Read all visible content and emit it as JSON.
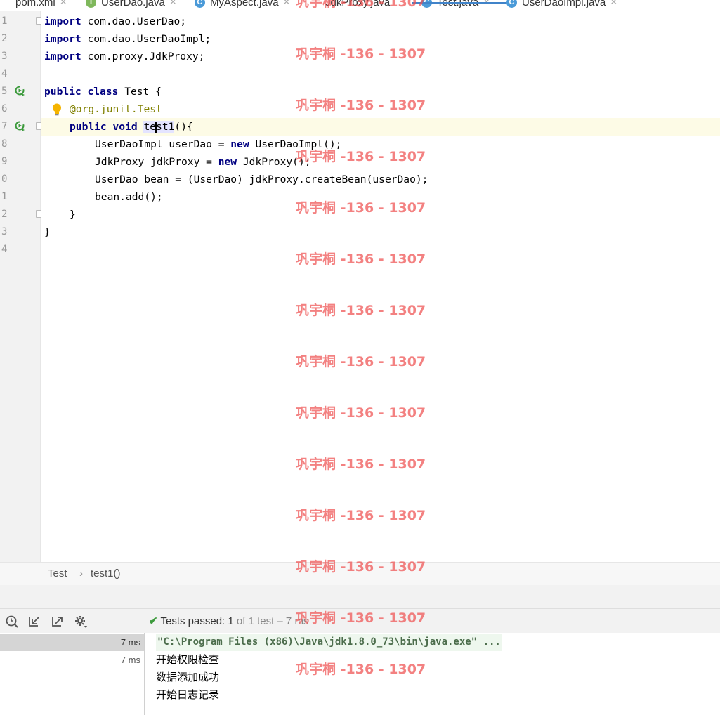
{
  "tabs": [
    {
      "label": "pom.xml",
      "icon": "maven-icon"
    },
    {
      "label": "UserDao.java",
      "icon": "interface-icon"
    },
    {
      "label": "MyAspect.java",
      "icon": "class-icon"
    },
    {
      "label": "JdkProxy.java",
      "icon": "class-icon"
    },
    {
      "label": "Test.java",
      "icon": "class-icon",
      "active": true
    },
    {
      "label": "UserDaoImpl.java",
      "icon": "class-icon"
    }
  ],
  "gutter": {
    "line_numbers": [
      "1",
      "2",
      "3",
      "4",
      "5",
      "6",
      "7",
      "8",
      "9",
      "0",
      "1",
      "2",
      "3",
      "4"
    ]
  },
  "code": {
    "l1": {
      "kw": "import",
      "rest": " com.dao.UserDao;"
    },
    "l2": {
      "kw": "import",
      "rest": " com.dao.UserDaoImpl;"
    },
    "l3": {
      "kw": "import",
      "rest": " com.proxy.JdkProxy;"
    },
    "l5": {
      "kw1": "public",
      "kw2": "class",
      "rest": " Test {"
    },
    "l6": {
      "prefix": "@org.junit.",
      "name": "Test"
    },
    "l7": {
      "kw1": "public",
      "kw2": "void",
      "ident_a": "te",
      "ident_b": "st1",
      "rest": "(){"
    },
    "l8": {
      "a": "UserDaoImpl userDao = ",
      "kw": "new",
      "b": " UserDaoImpl();"
    },
    "l9": {
      "a": "JdkProxy jdkProxy = ",
      "kw": "new",
      "b": " JdkProxy();"
    },
    "l10": "UserDao bean = (UserDao) jdkProxy.createBean(userDao);",
    "l11": "bean.add();",
    "l12": "}",
    "l13": "}"
  },
  "breadcrumb": {
    "items": [
      "Test",
      "test1()"
    ],
    "separator": "›"
  },
  "run": {
    "status_prefix": "Tests passed: ",
    "passed": "1",
    "status_suffix": " of 1 test – 7 ms",
    "tree": [
      {
        "time": "7 ms",
        "selected": true
      },
      {
        "time": "7 ms",
        "selected": false
      }
    ],
    "console": [
      "\"C:\\Program Files (x86)\\Java\\jdk1.8.0_73\\bin\\java.exe\" ...",
      "开始权限检查",
      "数据添加成功",
      "开始日志记录"
    ]
  },
  "watermark": "巩宇桐 -136 - 1307",
  "colors": {
    "keyword": "#000080",
    "annotation": "#808000",
    "tab_active_underline": "#4083c9",
    "watermark": "#ee5050"
  }
}
